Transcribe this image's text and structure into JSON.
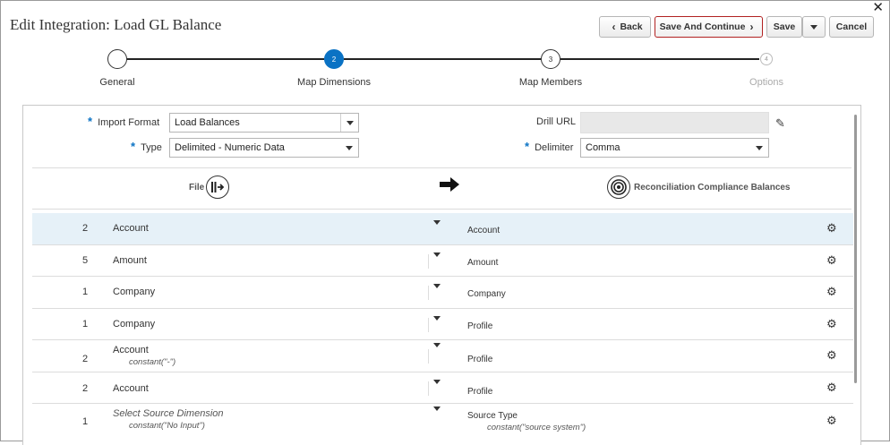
{
  "window": {
    "close_glyph": "✕"
  },
  "header": {
    "title": "Edit Integration: Load GL Balance",
    "buttons": {
      "back": "Back",
      "save_continue": "Save And Continue",
      "save": "Save",
      "cancel": "Cancel"
    }
  },
  "stepper": {
    "steps": [
      {
        "num": "",
        "label": "General",
        "state": "done"
      },
      {
        "num": "2",
        "label": "Map Dimensions",
        "state": "active"
      },
      {
        "num": "3",
        "label": "Map Members",
        "state": "next"
      },
      {
        "num": "4",
        "label": "Options",
        "state": "disabled"
      }
    ]
  },
  "form": {
    "import_format": {
      "label": "Import Format",
      "value": "Load Balances"
    },
    "type": {
      "label": "Type",
      "value": "Delimited - Numeric Data"
    },
    "drill_url": {
      "label": "Drill URL",
      "value": ""
    },
    "delimiter": {
      "label": "Delimiter",
      "value": "Comma"
    }
  },
  "mapping_header": {
    "source_label": "File",
    "target_label": "Reconciliation Compliance Balances",
    "source_icon": "file-import-icon",
    "target_icon": "target-icon",
    "arrow_icon": "arrow-right-icon"
  },
  "rows": [
    {
      "num": "2",
      "source": "Account",
      "source_sub": "",
      "target": "Account",
      "target_sub": "",
      "placeholder": false,
      "selected": true
    },
    {
      "num": "5",
      "source": "Amount",
      "source_sub": "",
      "target": "Amount",
      "target_sub": "",
      "placeholder": false,
      "selected": false
    },
    {
      "num": "1",
      "source": "Company",
      "source_sub": "",
      "target": "Company",
      "target_sub": "",
      "placeholder": false,
      "selected": false
    },
    {
      "num": "1",
      "source": "Company",
      "source_sub": "",
      "target": "Profile",
      "target_sub": "",
      "placeholder": false,
      "selected": false
    },
    {
      "num": "2",
      "source": "Account",
      "source_sub": "constant(\"-\")",
      "target": "Profile",
      "target_sub": "",
      "placeholder": false,
      "selected": false
    },
    {
      "num": "2",
      "source": "Account",
      "source_sub": "",
      "target": "Profile",
      "target_sub": "",
      "placeholder": false,
      "selected": false
    },
    {
      "num": "1",
      "source": "Select Source Dimension",
      "source_sub": "constant(\"No Input\")",
      "target": "Source Type",
      "target_sub": "constant(\"source system\")",
      "placeholder": true,
      "selected": false
    }
  ]
}
